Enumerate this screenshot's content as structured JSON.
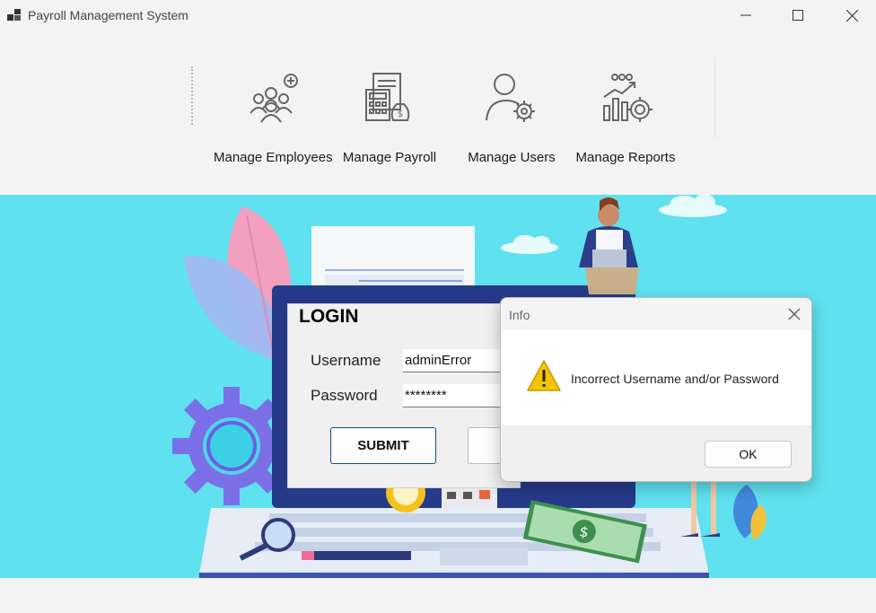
{
  "window": {
    "title": "Payroll Management System"
  },
  "toolbar": {
    "items": [
      {
        "label": "Manage Employees",
        "icon": "employees-icon"
      },
      {
        "label": "Manage Payroll",
        "icon": "payroll-calculator-icon"
      },
      {
        "label": "Manage Users",
        "icon": "user-settings-icon"
      },
      {
        "label": "Manage Reports",
        "icon": "reports-chart-icon"
      }
    ]
  },
  "login": {
    "title": "LOGIN",
    "username_label": "Username",
    "username_value": "adminError",
    "password_label": "Password",
    "password_value": "********",
    "submit_label": "SUBMIT"
  },
  "dialog": {
    "title": "Info",
    "message": "Incorrect Username and/or Password",
    "ok_label": "OK",
    "icon": "warning-icon"
  },
  "colors": {
    "background": "#5fe1ef",
    "toolbar": "#f3f3f3",
    "accent": "#0a4e86",
    "warning": "#f5c400"
  }
}
